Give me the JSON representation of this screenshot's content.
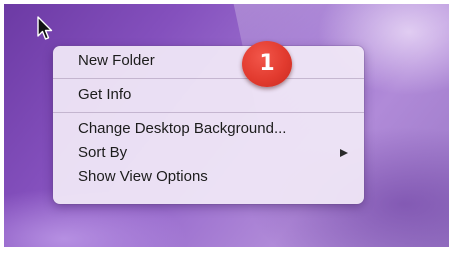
{
  "desktop": {
    "context_menu": {
      "items": [
        {
          "label": "New Folder"
        },
        {
          "label": "Get Info"
        },
        {
          "label": "Change Desktop Background..."
        },
        {
          "label": "Sort By",
          "submenu_indicator": "chevron-right-icon"
        },
        {
          "label": "Show View Options"
        }
      ]
    },
    "callout": {
      "number": "1",
      "color": "#e23b2f"
    },
    "cursor_icon": "arrow-pointer-icon"
  }
}
